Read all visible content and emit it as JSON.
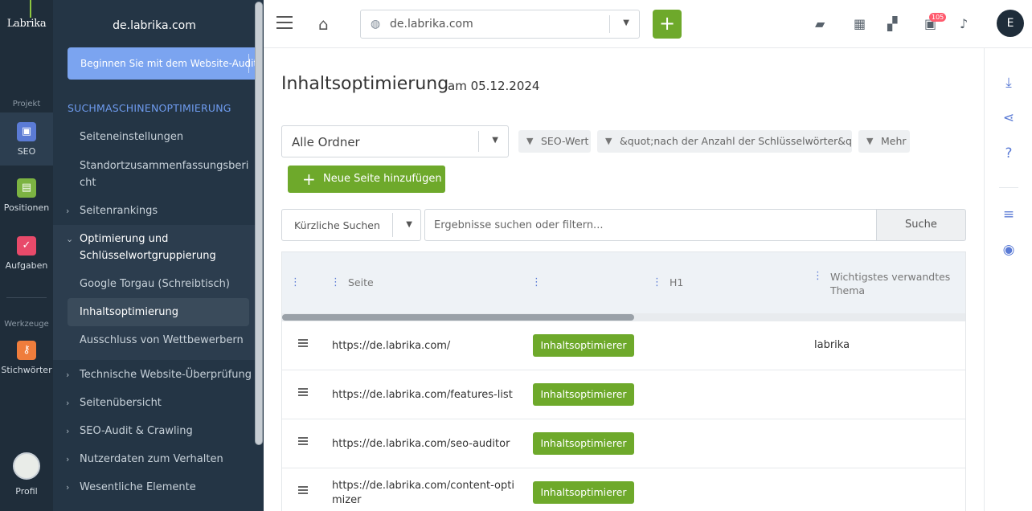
{
  "rail": {
    "logo": "Labrika",
    "group_project": "Projekt",
    "seo": "SEO",
    "positions": "Positionen",
    "tasks": "Aufgaben",
    "group_tools": "Werkzeuge",
    "keywords": "Stichwörter",
    "profile": "Profil"
  },
  "sidebar": {
    "project": "de.labrika.com",
    "audit_button": "Beginnen Sie mit dem Website-Audit",
    "section_title": "SUCHMASCHINENOPTIMIERUNG",
    "items": [
      "Seiteneinstellungen",
      "Standortzusammenfassungsbericht",
      "Seitenrankings",
      "Optimierung und Schlüsselwortgruppierung",
      "Google Torgau (Schreibtisch)",
      "Inhaltsoptimierung",
      "Ausschluss von Wettbewerbern",
      "Technische Website-Überprüfung",
      "Seitenübersicht",
      "SEO-Audit & Crawling",
      "Nutzerdaten zum Verhalten",
      "Wesentliche Elemente"
    ]
  },
  "topbar": {
    "site": "de.labrika.com",
    "plus": "+",
    "badge": "105",
    "user_initial": "E"
  },
  "main": {
    "title": "Inhaltsoptimierung",
    "date": "am 05.12.2024",
    "folder": "Alle Ordner",
    "chips": [
      "SEO-Wert",
      "&quot;nach der Anzahl der Schlüsselwörter&quot;",
      "Mehr"
    ],
    "add_page": "Neue Seite hinzufügen",
    "recent": "Kürzliche Suchen",
    "search_placeholder": "Ergebnisse suchen oder filtern...",
    "search_button": "Suche"
  },
  "table": {
    "columns": [
      "Seite",
      "H1",
      "Wichtigstes verwandtes Thema"
    ],
    "rows": [
      {
        "url": "https://de.labrika.com/",
        "action": "Inhaltsoptimierer",
        "topic": "labrika"
      },
      {
        "url": "https://de.labrika.com/features-list",
        "action": "Inhaltsoptimierer",
        "topic": ""
      },
      {
        "url": "https://de.labrika.com/seo-auditor",
        "action": "Inhaltsoptimierer",
        "topic": ""
      },
      {
        "url": "https://de.labrika.com/content-optimizer",
        "action": "Inhaltsoptimierer",
        "topic": ""
      }
    ]
  },
  "colors": {
    "accent_green": "#6ea92b",
    "sidebar_bg": "#243545",
    "rail_bg": "#1f2d3a",
    "link_blue": "#5b7bd5",
    "audit_button": "#7ba4f0"
  }
}
